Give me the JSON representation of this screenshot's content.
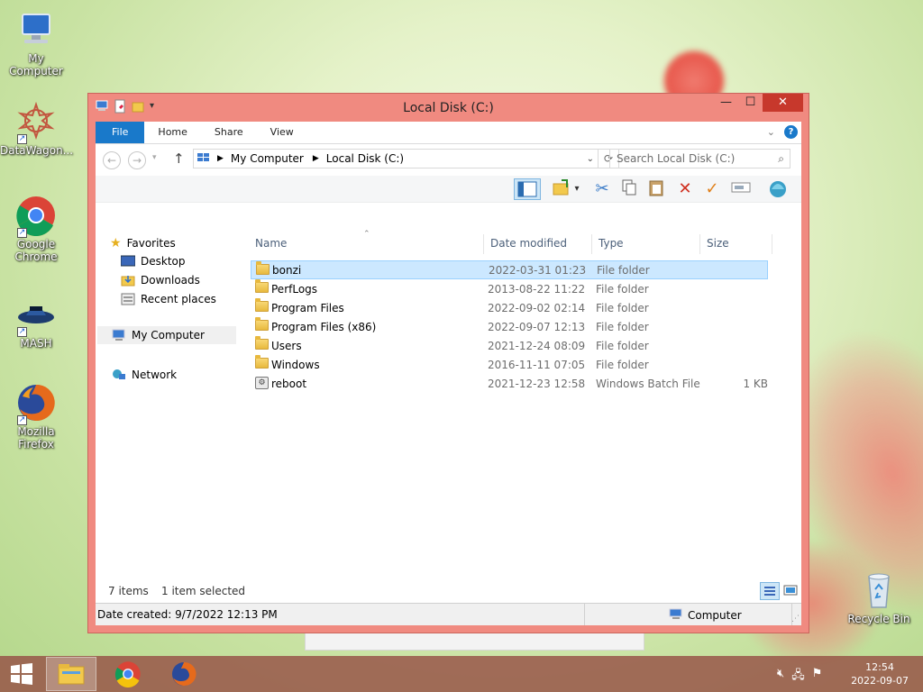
{
  "desktop": {
    "icons": [
      {
        "label": "My Computer"
      },
      {
        "label": "DataWagon..."
      },
      {
        "label": "Google Chrome"
      },
      {
        "label": "MASH"
      },
      {
        "label": "Mozilla Firefox"
      },
      {
        "label": "Recycle Bin"
      }
    ]
  },
  "window": {
    "title": "Local Disk (C:)",
    "ribbon_tabs": [
      "File",
      "Home",
      "Share",
      "View"
    ],
    "address": {
      "crumbs": [
        "My Computer",
        "Local Disk (C:)"
      ]
    },
    "search": {
      "placeholder": "Search Local Disk (C:)"
    },
    "nav": {
      "favorites": "Favorites",
      "desktop": "Desktop",
      "downloads": "Downloads",
      "recent": "Recent places",
      "computer": "My Computer",
      "network": "Network"
    },
    "columns": {
      "name": "Name",
      "date": "Date modified",
      "type": "Type",
      "size": "Size"
    },
    "files": [
      {
        "name": "bonzi",
        "date": "2022-03-31 01:23",
        "type": "File folder",
        "size": ""
      },
      {
        "name": "PerfLogs",
        "date": "2013-08-22 11:22",
        "type": "File folder",
        "size": ""
      },
      {
        "name": "Program Files",
        "date": "2022-09-02 02:14",
        "type": "File folder",
        "size": ""
      },
      {
        "name": "Program Files (x86)",
        "date": "2022-09-07 12:13",
        "type": "File folder",
        "size": ""
      },
      {
        "name": "Users",
        "date": "2021-12-24 08:09",
        "type": "File folder",
        "size": ""
      },
      {
        "name": "Windows",
        "date": "2016-11-11 07:05",
        "type": "File folder",
        "size": ""
      },
      {
        "name": "reboot",
        "date": "2021-12-23 12:58",
        "type": "Windows Batch File",
        "size": "1 KB"
      }
    ],
    "status": {
      "count": "7 items",
      "selected": "1 item selected"
    },
    "details_bar": {
      "created": "Date created: 9/7/2022 12:13 PM",
      "location": "Computer"
    }
  },
  "taskbar": {
    "time": "12:54",
    "date": "2022-09-07"
  }
}
